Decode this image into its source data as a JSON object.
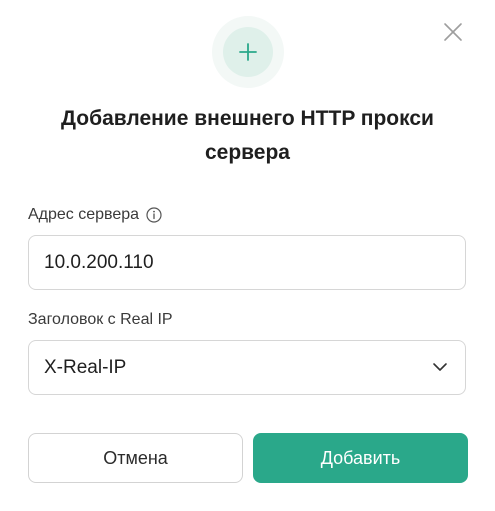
{
  "dialog": {
    "title": "Добавление внешнего HTTP прокси сервера",
    "header_icon": "plus-icon",
    "close_icon": "close-icon"
  },
  "form": {
    "server_address": {
      "label": "Адрес сервера",
      "info_icon": "info-icon",
      "value": "10.0.200.110"
    },
    "real_ip_header": {
      "label": "Заголовок с Real IP",
      "selected": "X-Real-IP",
      "dropdown_icon": "chevron-down-icon"
    }
  },
  "actions": {
    "cancel_label": "Отмена",
    "submit_label": "Добавить"
  },
  "colors": {
    "accent": "#2aa88a",
    "icon_bg": "#dff0ea",
    "icon_ring": "#f3f8f6",
    "border": "#d6d6d6"
  }
}
